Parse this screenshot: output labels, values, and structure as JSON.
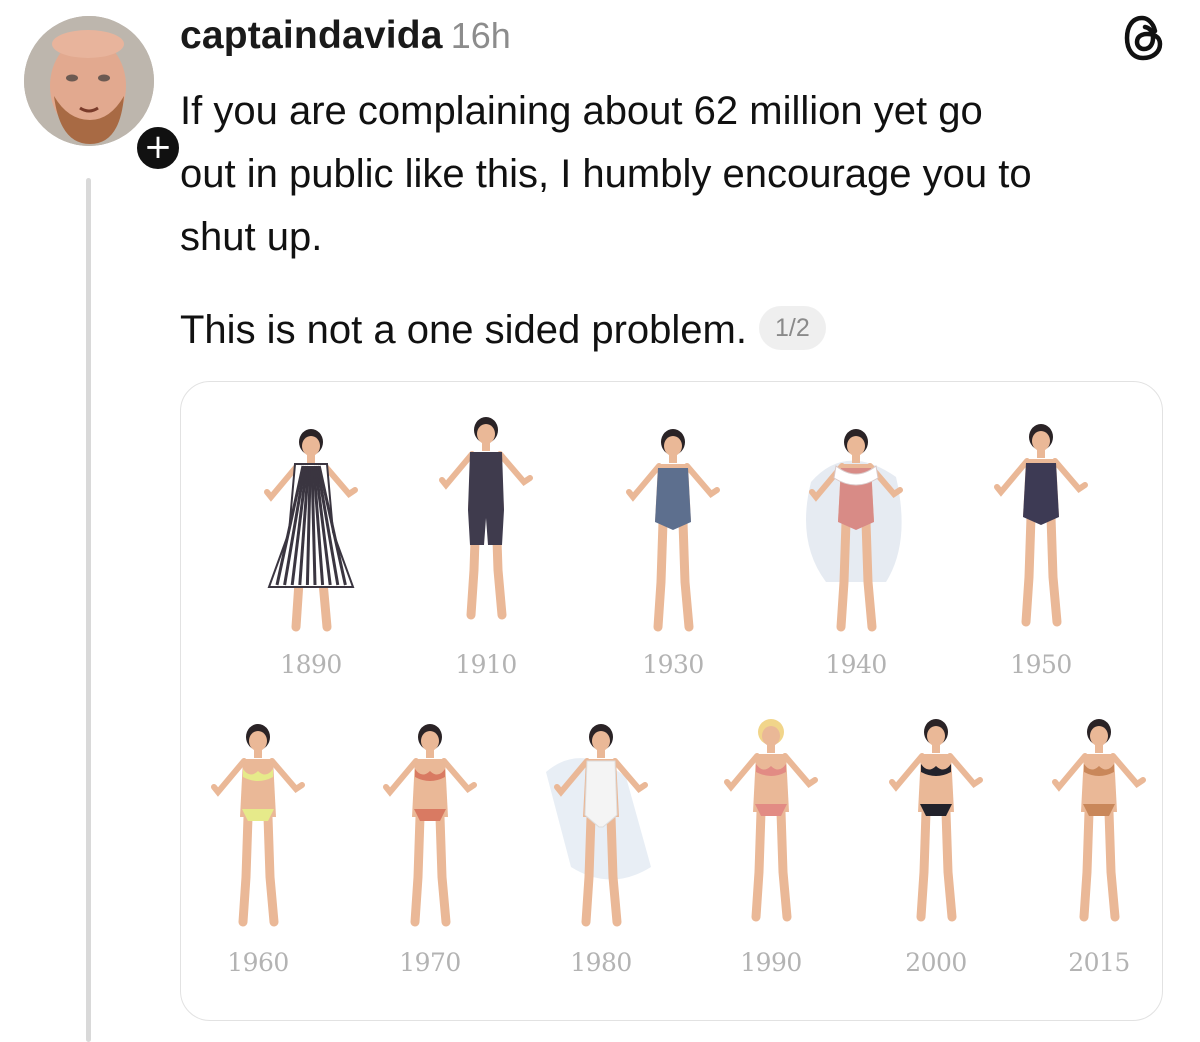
{
  "post": {
    "username": "captaindavida",
    "timestamp": "16h",
    "paragraphs": [
      "If you are complaining about 62 million yet go\nout in public like this, I humbly encourage you to\nshut up.",
      "This is not a one sided problem."
    ],
    "page_indicator": "1/2",
    "follow_symbol": "+"
  },
  "image": {
    "years": [
      "1890",
      "1910",
      "1930",
      "1940",
      "1950",
      "1960",
      "1970",
      "1980",
      "1990",
      "2000",
      "2015"
    ]
  },
  "colors": {
    "skin": "#eab897",
    "hair": "#2a2326",
    "label": "#b3b3b3",
    "thread_line": "#d9d9d9"
  },
  "icons": {
    "brand": "threads-logo-icon",
    "follow": "plus-icon"
  }
}
